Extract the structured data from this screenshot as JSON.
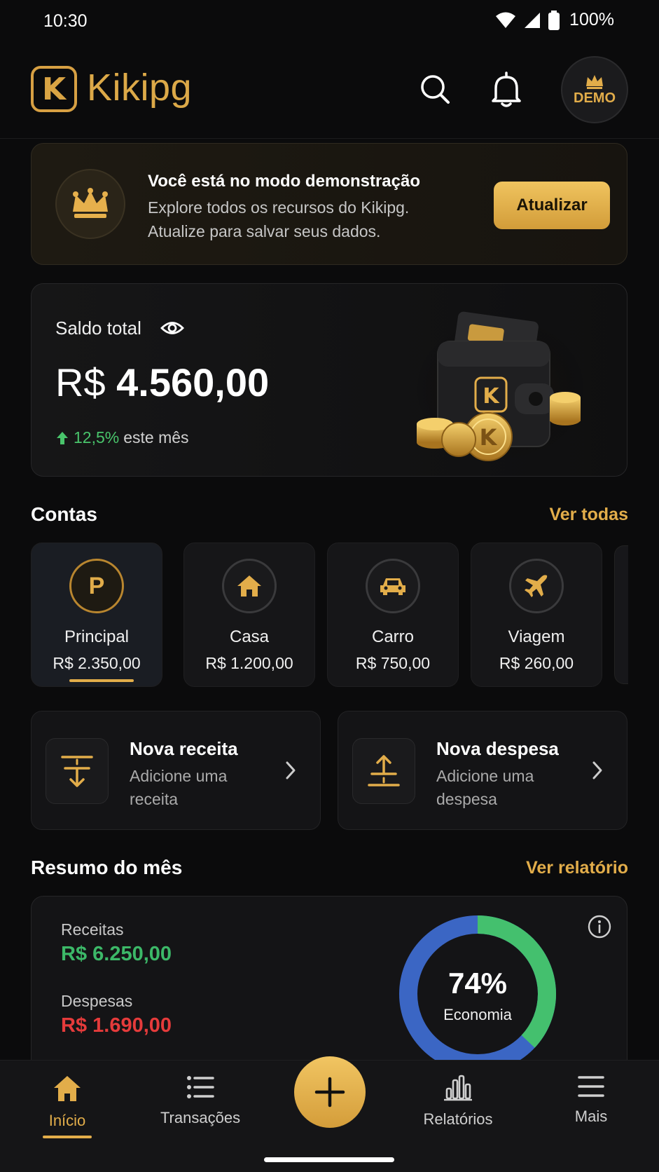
{
  "status_bar": {
    "time": "10:30",
    "battery": "100%"
  },
  "header": {
    "app_name": "Kikipg",
    "logo_letter": "K",
    "demo_label": "DEMO"
  },
  "banner": {
    "title": "Você está no modo demonstração",
    "line1": "Explore todos os recursos do Kikipg.",
    "line2": "Atualize para salvar seus dados.",
    "button": "Atualizar"
  },
  "balance": {
    "label": "Saldo total",
    "currency": "R$",
    "amount": "4.560,00",
    "trend_pct": "12,5%",
    "trend_text": "este mês"
  },
  "accounts": {
    "title": "Contas",
    "link": "Ver todas",
    "items": [
      {
        "name": "Principal",
        "value": "R$ 2.350,00",
        "icon": "p-letter-icon",
        "letter": "P"
      },
      {
        "name": "Casa",
        "value": "R$ 1.200,00",
        "icon": "house-icon"
      },
      {
        "name": "Carro",
        "value": "R$ 750,00",
        "icon": "car-icon"
      },
      {
        "name": "Viagem",
        "value": "R$ 260,00",
        "icon": "airplane-icon"
      }
    ]
  },
  "quick_actions": [
    {
      "title": "Nova receita",
      "sub": "Adicione uma receita",
      "icon": "income-icon"
    },
    {
      "title": "Nova despesa",
      "sub": "Adicione uma despesa",
      "icon": "expense-icon"
    }
  ],
  "summary": {
    "title": "Resumo do mês",
    "link": "Ver relatório",
    "income_label": "Receitas",
    "income_value": "R$ 6.250,00",
    "expense_label": "Despesas",
    "expense_value": "R$ 1.690,00",
    "savings_pct": "74%",
    "savings_label": "Economia",
    "savings_fraction": 0.74,
    "colors": {
      "income": "#3cb868",
      "expense": "#e53b3b",
      "ring_green": "#44c06e",
      "ring_blue": "#3b66c4"
    }
  },
  "nav": {
    "items": [
      {
        "label": "Início",
        "icon": "home-icon"
      },
      {
        "label": "Transações",
        "icon": "list-icon"
      },
      {
        "label": "Relatórios",
        "icon": "bar-chart-icon"
      },
      {
        "label": "Mais",
        "icon": "menu-icon"
      }
    ]
  },
  "colors": {
    "accent": "#e2ad4a",
    "background": "#0b0b0c",
    "positive": "#49c46b"
  }
}
